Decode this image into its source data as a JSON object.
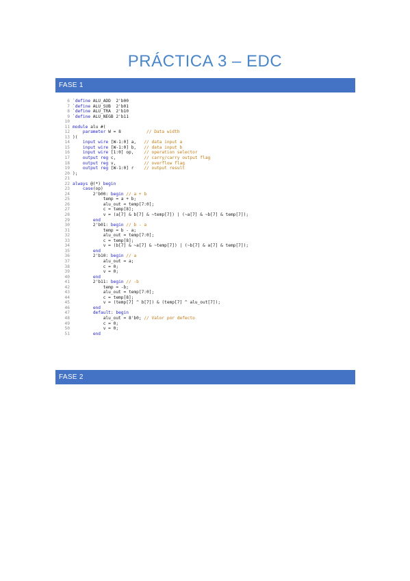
{
  "title": "PRÁCTICA 3 – EDC",
  "sections": {
    "fase1": "FASE 1",
    "fase2": "FASE 2"
  },
  "code_lines": [
    {
      "n": "6",
      "segs": [
        {
          "t": "kw",
          "v": "`define"
        },
        {
          "t": "tx",
          "v": " ALU_ADD  2'b00"
        }
      ]
    },
    {
      "n": "7",
      "segs": [
        {
          "t": "kw",
          "v": "`define"
        },
        {
          "t": "tx",
          "v": " ALU_SUB  2'b01"
        }
      ]
    },
    {
      "n": "8",
      "segs": [
        {
          "t": "kw",
          "v": "`define"
        },
        {
          "t": "tx",
          "v": " ALU_TRA  2'b10"
        }
      ]
    },
    {
      "n": "9",
      "segs": [
        {
          "t": "kw",
          "v": "`define"
        },
        {
          "t": "tx",
          "v": " ALU_NEGB 2'b11"
        }
      ]
    },
    {
      "n": "10",
      "segs": []
    },
    {
      "n": "11",
      "segs": [
        {
          "t": "kw",
          "v": "module"
        },
        {
          "t": "tx",
          "v": " alu #("
        }
      ]
    },
    {
      "n": "12",
      "segs": [
        {
          "t": "tx",
          "v": "    "
        },
        {
          "t": "kw",
          "v": "parameter"
        },
        {
          "t": "tx",
          "v": " W = 8          "
        },
        {
          "t": "cm",
          "v": "// Data width"
        }
      ]
    },
    {
      "n": "13",
      "segs": [
        {
          "t": "tx",
          "v": ")("
        }
      ]
    },
    {
      "n": "14",
      "segs": [
        {
          "t": "tx",
          "v": "    "
        },
        {
          "t": "kw",
          "v": "input wire"
        },
        {
          "t": "tx",
          "v": " [W-1:0] a,   "
        },
        {
          "t": "cm",
          "v": "// data input a"
        }
      ]
    },
    {
      "n": "15",
      "segs": [
        {
          "t": "tx",
          "v": "    "
        },
        {
          "t": "kw",
          "v": "input wire"
        },
        {
          "t": "tx",
          "v": " [W-1:0] b,   "
        },
        {
          "t": "cm",
          "v": "// data input b"
        }
      ]
    },
    {
      "n": "16",
      "segs": [
        {
          "t": "tx",
          "v": "    "
        },
        {
          "t": "kw",
          "v": "input wire"
        },
        {
          "t": "tx",
          "v": " [1:0] op,    "
        },
        {
          "t": "cm",
          "v": "// operation selector"
        }
      ]
    },
    {
      "n": "17",
      "segs": [
        {
          "t": "tx",
          "v": "    "
        },
        {
          "t": "kw",
          "v": "output reg"
        },
        {
          "t": "tx",
          "v": " c,           "
        },
        {
          "t": "cm",
          "v": "// carry/carry output flag"
        }
      ]
    },
    {
      "n": "18",
      "segs": [
        {
          "t": "tx",
          "v": "    "
        },
        {
          "t": "kw",
          "v": "output reg"
        },
        {
          "t": "tx",
          "v": " v,           "
        },
        {
          "t": "cm",
          "v": "// overflow flag"
        }
      ]
    },
    {
      "n": "19",
      "segs": [
        {
          "t": "tx",
          "v": "    "
        },
        {
          "t": "kw",
          "v": "output reg"
        },
        {
          "t": "tx",
          "v": " [W-1:0] r    "
        },
        {
          "t": "cm",
          "v": "// output result"
        }
      ]
    },
    {
      "n": "20",
      "segs": [
        {
          "t": "tx",
          "v": ");"
        }
      ]
    },
    {
      "n": "21",
      "segs": []
    },
    {
      "n": "22",
      "segs": [
        {
          "t": "kw",
          "v": "always"
        },
        {
          "t": "tx",
          "v": " @(*) "
        },
        {
          "t": "kw",
          "v": "begin"
        }
      ]
    },
    {
      "n": "23",
      "segs": [
        {
          "t": "tx",
          "v": "    "
        },
        {
          "t": "kw",
          "v": "case"
        },
        {
          "t": "tx",
          "v": "(op)"
        }
      ]
    },
    {
      "n": "24",
      "segs": [
        {
          "t": "tx",
          "v": "        2'b00: "
        },
        {
          "t": "kw",
          "v": "begin"
        },
        {
          "t": "tx",
          "v": " "
        },
        {
          "t": "cm",
          "v": "// a + b"
        }
      ]
    },
    {
      "n": "25",
      "segs": [
        {
          "t": "tx",
          "v": "            temp = a + b;"
        }
      ]
    },
    {
      "n": "26",
      "segs": [
        {
          "t": "tx",
          "v": "            alu_out = temp[7:0];"
        }
      ]
    },
    {
      "n": "27",
      "segs": [
        {
          "t": "tx",
          "v": "            c = temp[8];"
        }
      ]
    },
    {
      "n": "28",
      "segs": [
        {
          "t": "tx",
          "v": "            v = (a[7] & b[7] & ~temp[7]) | (~a[7] & ~b[7] & temp[7]);"
        }
      ]
    },
    {
      "n": "29",
      "segs": [
        {
          "t": "tx",
          "v": "        "
        },
        {
          "t": "kw",
          "v": "end"
        }
      ]
    },
    {
      "n": "30",
      "segs": [
        {
          "t": "tx",
          "v": "        2'b01: "
        },
        {
          "t": "kw",
          "v": "begin"
        },
        {
          "t": "tx",
          "v": " "
        },
        {
          "t": "cm",
          "v": "// b - a"
        }
      ]
    },
    {
      "n": "31",
      "segs": [
        {
          "t": "tx",
          "v": "            temp = b - a;"
        }
      ]
    },
    {
      "n": "32",
      "segs": [
        {
          "t": "tx",
          "v": "            alu_out = temp[7:0];"
        }
      ]
    },
    {
      "n": "33",
      "segs": [
        {
          "t": "tx",
          "v": "            c = temp[8];"
        }
      ]
    },
    {
      "n": "34",
      "segs": [
        {
          "t": "tx",
          "v": "            v = (b[7] & ~a[7] & ~temp[7]) | (~b[7] & a[7] & temp[7]);"
        }
      ]
    },
    {
      "n": "35",
      "segs": [
        {
          "t": "tx",
          "v": "        "
        },
        {
          "t": "kw",
          "v": "end"
        }
      ]
    },
    {
      "n": "36",
      "segs": [
        {
          "t": "tx",
          "v": "        2'b10: "
        },
        {
          "t": "kw",
          "v": "begin"
        },
        {
          "t": "tx",
          "v": " "
        },
        {
          "t": "cm",
          "v": "// a"
        }
      ]
    },
    {
      "n": "37",
      "segs": [
        {
          "t": "tx",
          "v": "            alu_out = a;"
        }
      ]
    },
    {
      "n": "38",
      "segs": [
        {
          "t": "tx",
          "v": "            c = 0;"
        }
      ]
    },
    {
      "n": "39",
      "segs": [
        {
          "t": "tx",
          "v": "            v = 0;"
        }
      ]
    },
    {
      "n": "40",
      "segs": [
        {
          "t": "tx",
          "v": "        "
        },
        {
          "t": "kw",
          "v": "end"
        }
      ]
    },
    {
      "n": "41",
      "segs": [
        {
          "t": "tx",
          "v": "        2'b11: "
        },
        {
          "t": "kw",
          "v": "begin"
        },
        {
          "t": "tx",
          "v": " "
        },
        {
          "t": "cm",
          "v": "// -b"
        }
      ]
    },
    {
      "n": "42",
      "segs": [
        {
          "t": "tx",
          "v": "            temp = -b;"
        }
      ]
    },
    {
      "n": "43",
      "segs": [
        {
          "t": "tx",
          "v": "            alu_out = temp[7:0];"
        }
      ]
    },
    {
      "n": "44",
      "segs": [
        {
          "t": "tx",
          "v": "            c = temp[8];"
        }
      ]
    },
    {
      "n": "45",
      "segs": [
        {
          "t": "tx",
          "v": "            v = (temp[7] ^ b[7]) & (temp[7] ^ alu_out[7]);"
        }
      ]
    },
    {
      "n": "46",
      "segs": [
        {
          "t": "tx",
          "v": "        "
        },
        {
          "t": "kw",
          "v": "end"
        }
      ]
    },
    {
      "n": "47",
      "segs": [
        {
          "t": "tx",
          "v": "        "
        },
        {
          "t": "kw",
          "v": "default"
        },
        {
          "t": "tx",
          "v": ": "
        },
        {
          "t": "kw",
          "v": "begin"
        }
      ]
    },
    {
      "n": "48",
      "segs": [
        {
          "t": "tx",
          "v": "            alu_out = 8'b0; "
        },
        {
          "t": "cm",
          "v": "// Valor por defecto"
        }
      ]
    },
    {
      "n": "49",
      "segs": [
        {
          "t": "tx",
          "v": "            c = 0;"
        }
      ]
    },
    {
      "n": "50",
      "segs": [
        {
          "t": "tx",
          "v": "            v = 0;"
        }
      ]
    },
    {
      "n": "51",
      "segs": [
        {
          "t": "tx",
          "v": "        "
        },
        {
          "t": "kw",
          "v": "end"
        }
      ]
    }
  ]
}
